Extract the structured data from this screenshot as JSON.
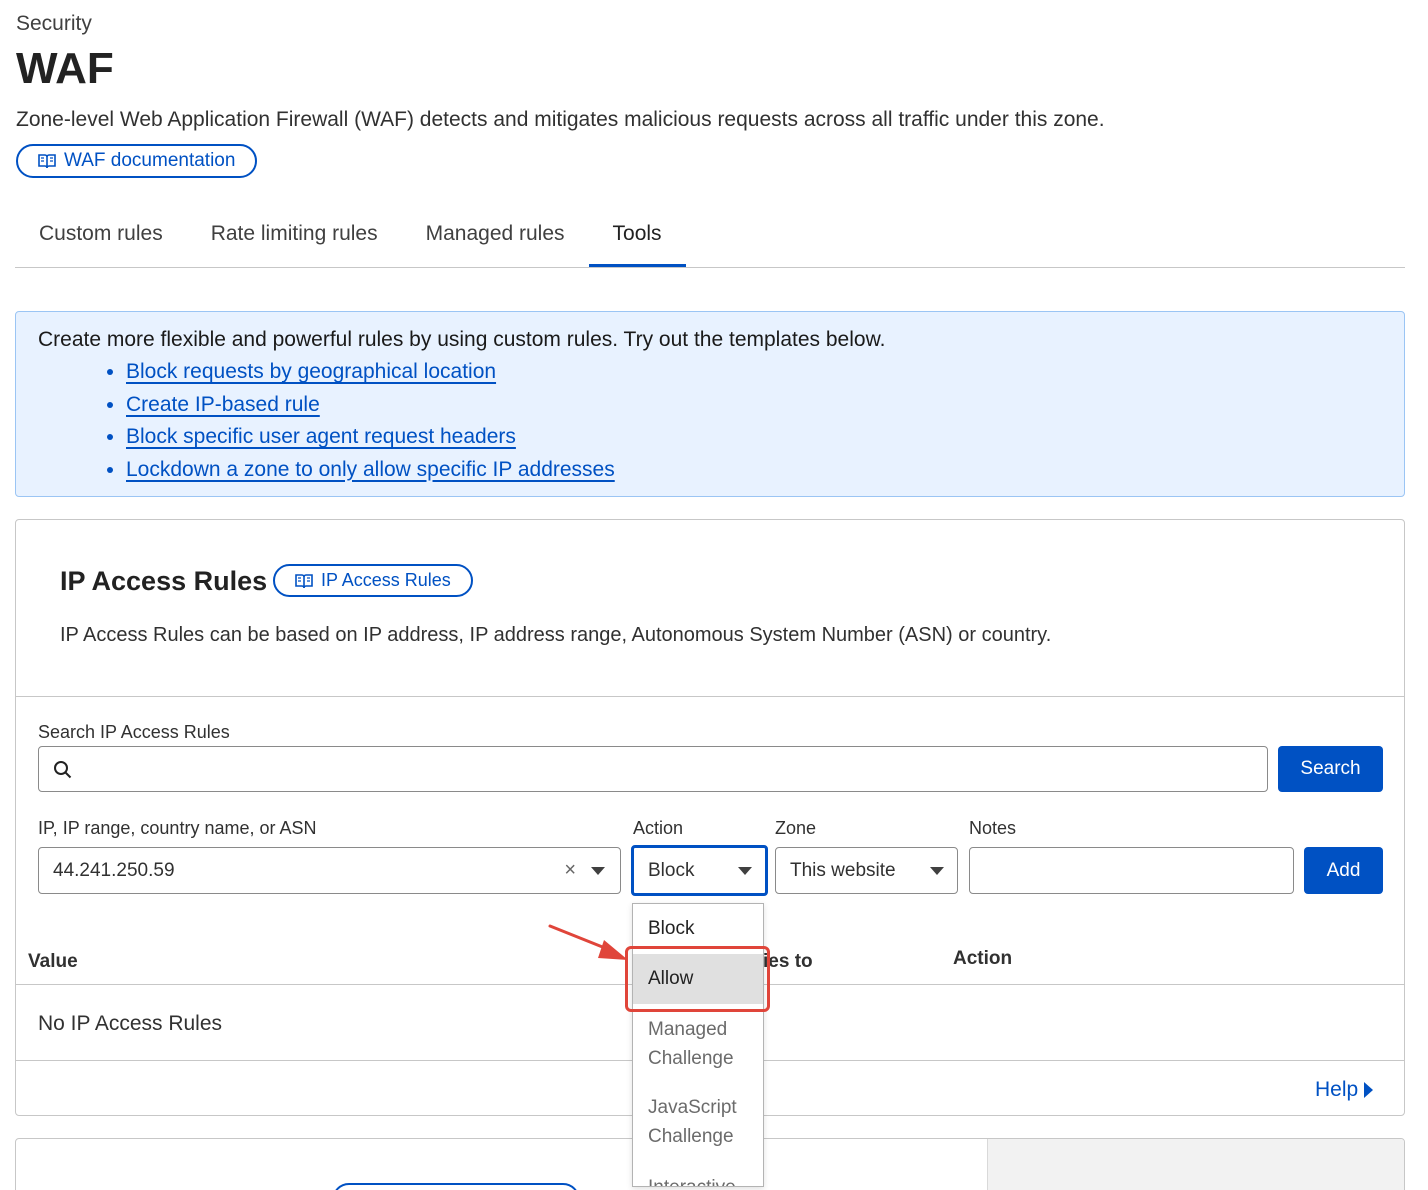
{
  "header": {
    "breadcrumb": "Security",
    "title": "WAF",
    "description": "Zone-level Web Application Firewall (WAF) detects and mitigates malicious requests across all traffic under this zone.",
    "doc_button": "WAF documentation",
    "doc_icon": "book-icon"
  },
  "tabs": [
    {
      "label": "Custom rules",
      "active": false
    },
    {
      "label": "Rate limiting rules",
      "active": false
    },
    {
      "label": "Managed rules",
      "active": false
    },
    {
      "label": "Tools",
      "active": true
    }
  ],
  "info": {
    "text": "Create more flexible and powerful rules by using custom rules. Try out the templates below.",
    "links": [
      "Block requests by geographical location",
      "Create IP-based rule",
      "Block specific user agent request headers",
      "Lockdown a zone to only allow specific IP addresses"
    ]
  },
  "ip_access": {
    "title": "IP Access Rules",
    "doc_button": "IP Access Rules",
    "description": "IP Access Rules can be based on IP address, IP address range, Autonomous System Number (ASN) or country.",
    "search": {
      "label": "Search IP Access Rules",
      "value": "",
      "button": "Search",
      "icon": "search-icon"
    },
    "form": {
      "ip_label": "IP, IP range, country name, or ASN",
      "ip_value": "44.241.250.59",
      "clear": "×",
      "action_label": "Action",
      "action_value": "Block",
      "zone_label": "Zone",
      "zone_value": "This website",
      "notes_label": "Notes",
      "notes_value": "",
      "add_button": "Add"
    },
    "table": {
      "col_value": "Value",
      "col_applies_partial": "ies to",
      "col_action": "Action",
      "empty": "No IP Access Rules"
    },
    "help": "Help"
  },
  "action_dropdown": {
    "options": [
      {
        "label": "Block",
        "line1": "Block",
        "line2": ""
      },
      {
        "label": "Allow",
        "line1": "Allow",
        "line2": "",
        "hovered": true
      },
      {
        "label": "Managed Challenge",
        "line1": "Managed",
        "line2": "Challenge"
      },
      {
        "label": "JavaScript Challenge",
        "line1": "JavaScript",
        "line2": "Challenge"
      },
      {
        "label": "Interactive",
        "line1": "Interactive",
        "line2": ""
      }
    ]
  },
  "annotation": {
    "arrow_color": "#e0453a",
    "highlight_color": "#e0453a"
  },
  "colors": {
    "accent": "#0051c3",
    "info_bg": "#e8f2ff",
    "info_border": "#9bc5f4"
  }
}
